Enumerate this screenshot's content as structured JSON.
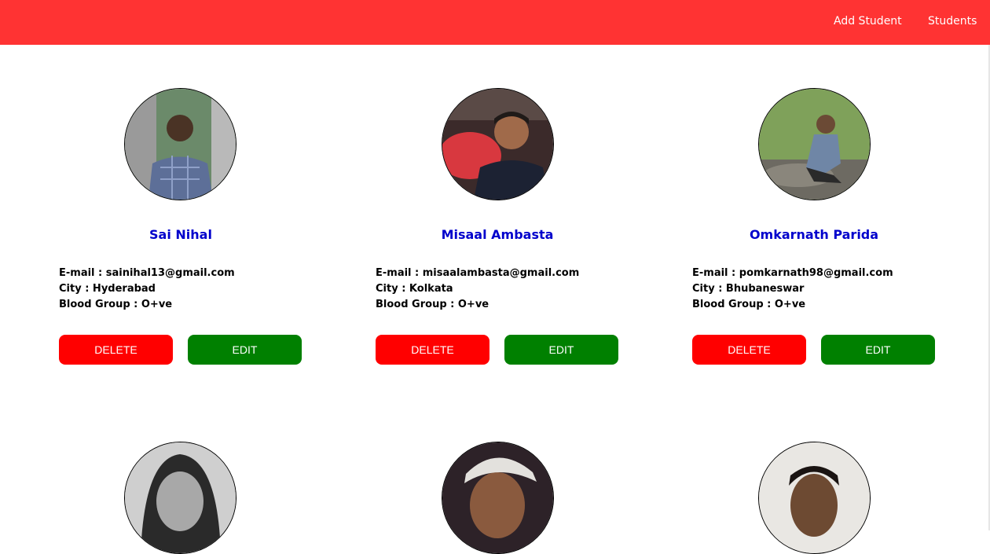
{
  "nav": {
    "add_student": "Add Student",
    "students": "Students"
  },
  "colors": {
    "navbar": "#ff3333",
    "name": "#0000cc",
    "delete": "#ff0000",
    "edit": "#008000"
  },
  "students": [
    {
      "name": "Sai Nihal",
      "email": "E-mail : sainihal13@gmail.com",
      "city": "City : Hyderabad",
      "blood": "Blood Group : O+ve",
      "delete_label": "DELETE",
      "edit_label": "EDIT"
    },
    {
      "name": "Misaal Ambasta",
      "email": "E-mail : misaalambasta@gmail.com",
      "city": "City : Kolkata",
      "blood": "Blood Group : O+ve",
      "delete_label": "DELETE",
      "edit_label": "EDIT"
    },
    {
      "name": "Omkarnath Parida",
      "email": "E-mail : pomkarnath98@gmail.com",
      "city": "City : Bhubaneswar",
      "blood": "Blood Group : O+ve",
      "delete_label": "DELETE",
      "edit_label": "EDIT"
    }
  ]
}
